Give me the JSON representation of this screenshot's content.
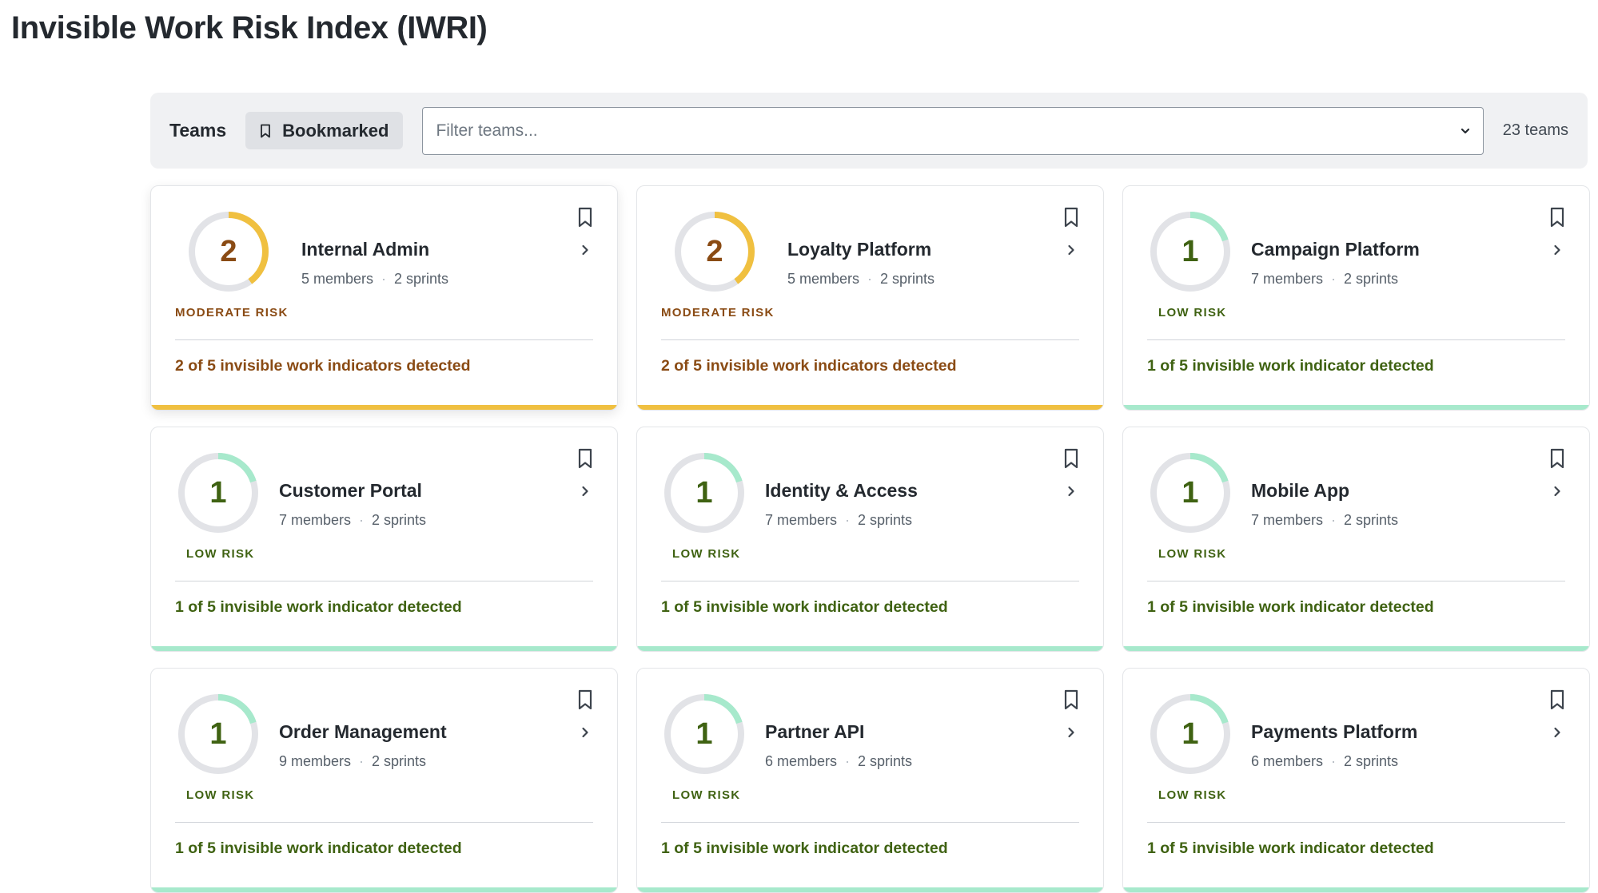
{
  "page": {
    "title": "Invisible Work Risk Index (IWRI)"
  },
  "toolbar": {
    "teams_label": "Teams",
    "bookmarked_label": "Bookmarked",
    "filter_placeholder": "Filter teams...",
    "team_count": "23 teams"
  },
  "colors": {
    "moderate": "#f0c040",
    "moderate_text": "#8a4b14",
    "low": "#a7e9cc",
    "low_text": "#3f6212",
    "track": "#e2e3e7"
  },
  "icons": {
    "bookmark": "bookmark-icon",
    "chevron_down": "chevron-down-icon",
    "chevron_right": "chevron-right-icon"
  },
  "teams": [
    {
      "name": "Internal Admin",
      "members": "5 members",
      "sprints": "2 sprints",
      "score": "2",
      "score_value": 2,
      "max_score": 5,
      "risk": "MODERATE RISK",
      "level": "moderate",
      "indicators": "2 of 5 invisible work indicators detected"
    },
    {
      "name": "Loyalty Platform",
      "members": "5 members",
      "sprints": "2 sprints",
      "score": "2",
      "score_value": 2,
      "max_score": 5,
      "risk": "MODERATE RISK",
      "level": "moderate",
      "indicators": "2 of 5 invisible work indicators detected"
    },
    {
      "name": "Campaign Platform",
      "members": "7 members",
      "sprints": "2 sprints",
      "score": "1",
      "score_value": 1,
      "max_score": 5,
      "risk": "LOW RISK",
      "level": "low",
      "indicators": "1 of 5 invisible work indicator detected"
    },
    {
      "name": "Customer Portal",
      "members": "7 members",
      "sprints": "2 sprints",
      "score": "1",
      "score_value": 1,
      "max_score": 5,
      "risk": "LOW RISK",
      "level": "low",
      "indicators": "1 of 5 invisible work indicator detected"
    },
    {
      "name": "Identity & Access",
      "members": "7 members",
      "sprints": "2 sprints",
      "score": "1",
      "score_value": 1,
      "max_score": 5,
      "risk": "LOW RISK",
      "level": "low",
      "indicators": "1 of 5 invisible work indicator detected"
    },
    {
      "name": "Mobile App",
      "members": "7 members",
      "sprints": "2 sprints",
      "score": "1",
      "score_value": 1,
      "max_score": 5,
      "risk": "LOW RISK",
      "level": "low",
      "indicators": "1 of 5 invisible work indicator detected"
    },
    {
      "name": "Order Management",
      "members": "9 members",
      "sprints": "2 sprints",
      "score": "1",
      "score_value": 1,
      "max_score": 5,
      "risk": "LOW RISK",
      "level": "low",
      "indicators": "1 of 5 invisible work indicator detected"
    },
    {
      "name": "Partner API",
      "members": "6 members",
      "sprints": "2 sprints",
      "score": "1",
      "score_value": 1,
      "max_score": 5,
      "risk": "LOW RISK",
      "level": "low",
      "indicators": "1 of 5 invisible work indicator detected"
    },
    {
      "name": "Payments Platform",
      "members": "6 members",
      "sprints": "2 sprints",
      "score": "1",
      "score_value": 1,
      "max_score": 5,
      "risk": "LOW RISK",
      "level": "low",
      "indicators": "1 of 5 invisible work indicator detected"
    }
  ]
}
